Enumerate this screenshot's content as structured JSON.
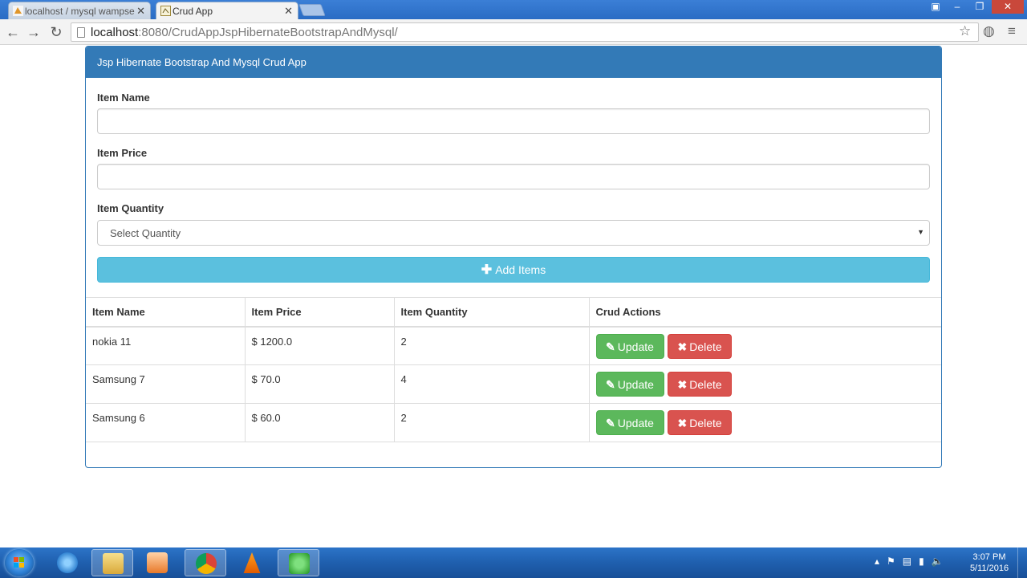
{
  "browser": {
    "tabs": [
      {
        "title": "localhost / mysql wampse",
        "active": false
      },
      {
        "title": "Crud App",
        "active": true
      }
    ],
    "url": {
      "host": "localhost",
      "rest": ":8080/CrudAppJspHibernateBootstrapAndMysql/"
    }
  },
  "panel": {
    "heading": "Jsp Hibernate Bootstrap And Mysql Crud App"
  },
  "form": {
    "item_name_label": "Item Name",
    "item_price_label": "Item Price",
    "item_quantity_label": "Item Quantity",
    "quantity_placeholder": "Select Quantity",
    "add_button": "Add Items"
  },
  "table": {
    "headers": [
      "Item Name",
      "Item Price",
      "Item Quantity",
      "Crud Actions"
    ],
    "rows": [
      {
        "name": "nokia 11",
        "price": "$ 1200.0",
        "quantity": "2"
      },
      {
        "name": "Samsung 7",
        "price": "$ 70.0",
        "quantity": "4"
      },
      {
        "name": "Samsung 6",
        "price": "$ 60.0",
        "quantity": "2"
      }
    ],
    "update_label": "Update",
    "delete_label": "Delete"
  },
  "taskbar": {
    "time": "3:07 PM",
    "date": "5/11/2016"
  },
  "colors": {
    "primary": "#337ab7",
    "info": "#5bc0de",
    "success": "#5cb85c",
    "danger": "#d9534f"
  }
}
